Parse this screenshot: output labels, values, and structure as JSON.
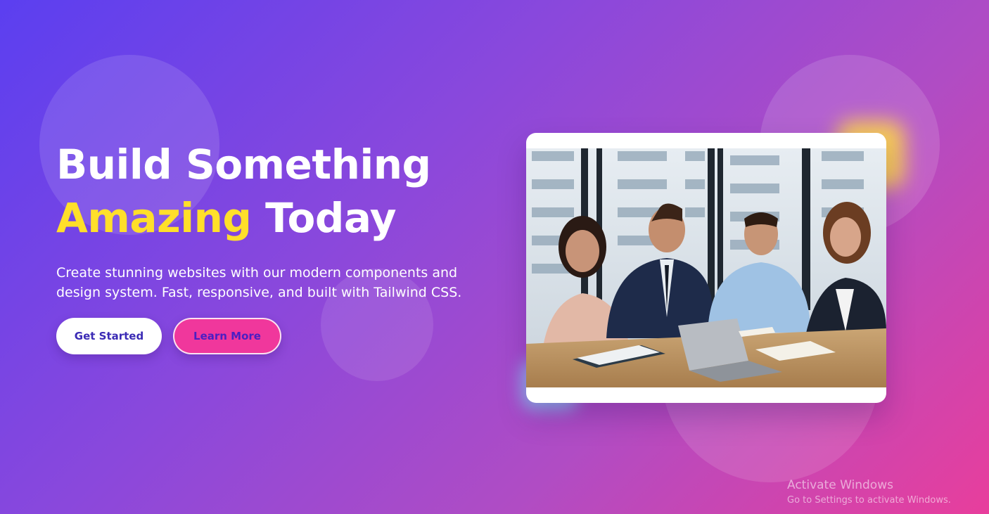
{
  "hero": {
    "headline_line1": "Build Something",
    "headline_accent": "Amazing",
    "headline_rest": "Today",
    "subtitle": "Create stunning websites with our modern components and design system. Fast, responsive, and built with Tailwind CSS.",
    "colors": {
      "gradient_start": "#5b3ff0",
      "gradient_end": "#e83e9c",
      "accent_text": "#ffdf2a"
    }
  },
  "buttons": {
    "get_started": "Get Started",
    "learn_more": "Learn More"
  },
  "image": {
    "icon": "team-meeting-photo"
  },
  "watermark": {
    "title": "Activate Windows",
    "subtitle": "Go to Settings to activate Windows."
  }
}
